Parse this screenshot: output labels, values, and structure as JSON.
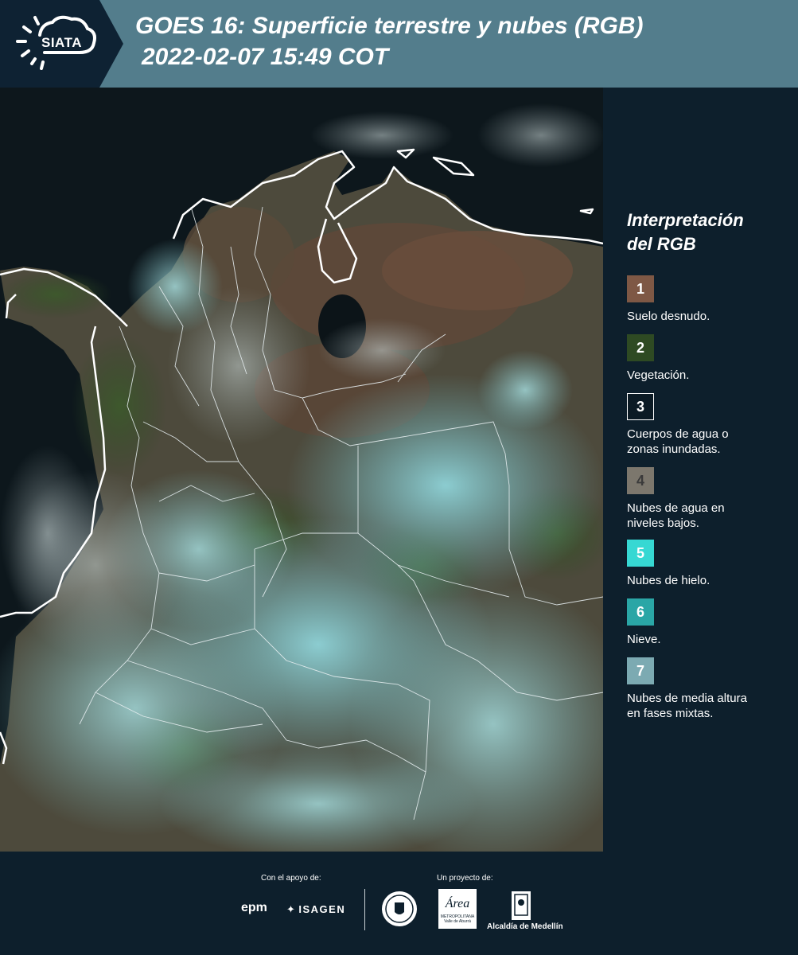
{
  "header": {
    "logo": "SIATA",
    "title_line1": "GOES 16: Superficie terrestre y nubes (RGB)",
    "title_line2": "2022-02-07 15:49 COT"
  },
  "legend": {
    "title_line1": "Interpretación",
    "title_line2": "del RGB",
    "items": [
      {
        "number": "1",
        "label_line1": "Suelo desnudo.",
        "label_line2": "",
        "color": "#7e5845"
      },
      {
        "number": "2",
        "label_line1": "Vegetación.",
        "label_line2": "",
        "color": "#2e4a23"
      },
      {
        "number": "3",
        "label_line1": "Cuerpos de agua o",
        "label_line2": "zonas inundadas.",
        "color": "#0b1a24"
      },
      {
        "number": "4",
        "label_line1": "Nubes de agua en",
        "label_line2": "niveles bajos.",
        "color": "#7c776d"
      },
      {
        "number": "5",
        "label_line1": "Nubes de hielo.",
        "label_line2": "",
        "color": "#36d8d3"
      },
      {
        "number": "6",
        "label_line1": "Nieve.",
        "label_line2": "",
        "color": "#2aa6a6"
      },
      {
        "number": "7",
        "label_line1": "Nubes de media altura",
        "label_line2": "en fases mixtas.",
        "color": "#7caab2"
      }
    ]
  },
  "footer": {
    "support_label": "Con el apoyo de:",
    "project_label": "Un proyecto de:",
    "epm_logo": "epm",
    "isagen_logo": "ISAGEN",
    "metropolitana_logo": "Área",
    "metropolitana_sub1": "METROPOLITANA",
    "metropolitana_sub2": "Valle de Aburrá",
    "alcaldia_logo": "Alcaldía de Medellín"
  }
}
